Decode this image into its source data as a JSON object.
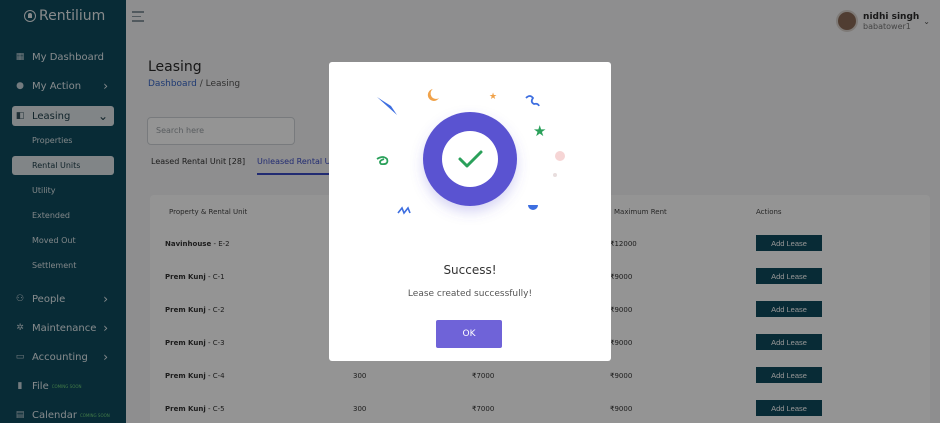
{
  "app": {
    "logo_text": "Rentilium"
  },
  "sidebar": {
    "items": [
      {
        "label": "My Dashboard",
        "icon": "grid-icon"
      },
      {
        "label": "My Action",
        "icon": "user-icon"
      },
      {
        "label": "Leasing",
        "icon": "lease-icon"
      },
      {
        "label": "People",
        "icon": "people-icon"
      },
      {
        "label": "Maintenance",
        "icon": "wrench-icon"
      },
      {
        "label": "Accounting",
        "icon": "ledger-icon"
      },
      {
        "label": "File",
        "icon": "file-icon",
        "badge": "COMING SOON"
      },
      {
        "label": "Calendar",
        "icon": "calendar-icon",
        "badge": "COMING SOON"
      }
    ],
    "sub_items": [
      {
        "label": "Properties"
      },
      {
        "label": "Rental Units"
      },
      {
        "label": "Utility"
      },
      {
        "label": "Extended"
      },
      {
        "label": "Moved Out"
      },
      {
        "label": "Settlement"
      }
    ]
  },
  "user": {
    "name": "nidhi singh",
    "subtitle": "babatower1"
  },
  "main": {
    "title": "Leasing",
    "breadcrumb": {
      "link": "Dashboard",
      "separator": "/",
      "current": "Leasing"
    },
    "search_placeholder": "Search here",
    "tabs": [
      {
        "label": "Leased Rental Unit [28]"
      },
      {
        "label": "Unleased Rental Ur"
      }
    ],
    "table": {
      "headers": [
        "Property & Rental Unit",
        "Maximum Rent",
        "Actions"
      ],
      "rows": [
        {
          "property": "Navinhouse",
          "unit": " - E-2",
          "col2": "",
          "col3": "",
          "max_rent": "₹12000",
          "action": "Add Lease"
        },
        {
          "property": "Prem Kunj",
          "unit": " - C-1",
          "col2": "",
          "col3": "",
          "max_rent": "₹9000",
          "action": "Add Lease"
        },
        {
          "property": "Prem Kunj",
          "unit": " - C-2",
          "col2": "",
          "col3": "",
          "max_rent": "₹9000",
          "action": "Add Lease"
        },
        {
          "property": "Prem Kunj",
          "unit": " - C-3",
          "col2": "",
          "col3": "",
          "max_rent": "₹9000",
          "action": "Add Lease"
        },
        {
          "property": "Prem Kunj",
          "unit": " - C-4",
          "col2": "300",
          "col3": "₹7000",
          "max_rent": "₹9000",
          "action": "Add Lease"
        },
        {
          "property": "Prem Kunj",
          "unit": " - C-5",
          "col2": "300",
          "col3": "₹7000",
          "max_rent": "₹9000",
          "action": "Add Lease"
        }
      ]
    }
  },
  "modal": {
    "title": "Success!",
    "message": "Lease created successfully!",
    "ok_label": "OK",
    "colors": {
      "circle": "#5a53d1",
      "button": "#6f63d8"
    }
  }
}
